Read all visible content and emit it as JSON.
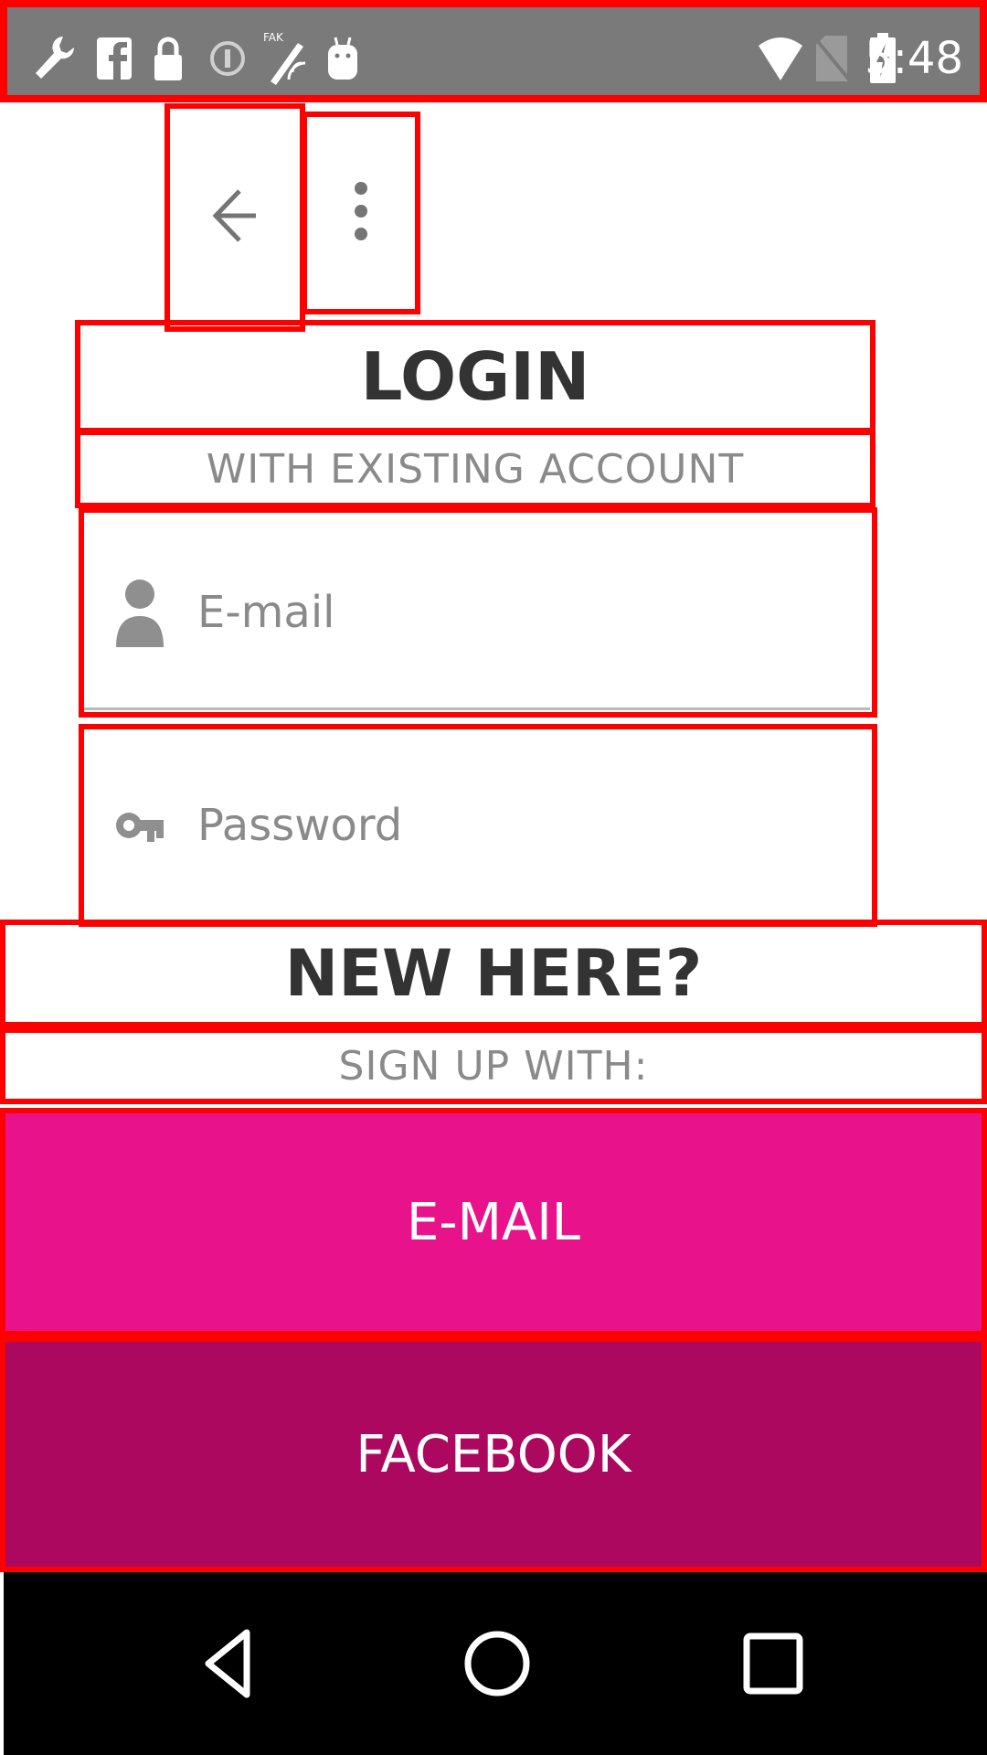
{
  "status_bar": {
    "time": "5:48",
    "left_icons": [
      "wrench-icon",
      "facebook-icon",
      "lock-icon",
      "circle-i-icon",
      "fake-gps-icon",
      "android-icon"
    ],
    "right_icons": [
      "wifi-icon",
      "no-sim-icon",
      "battery-charging-icon"
    ],
    "background": "#7a7a7a"
  },
  "toolbar": {
    "back_icon": "arrow-left-icon",
    "more_icon": "more-vert-icon"
  },
  "login": {
    "title": "LOGIN",
    "subtitle": "WITH EXISTING ACCOUNT",
    "email_placeholder": "E-mail",
    "email_icon": "person-icon",
    "password_placeholder": "Password",
    "password_icon": "key-icon"
  },
  "signup": {
    "title": "NEW HERE?",
    "subtitle": "SIGN UP WITH:",
    "email_button": "E-MAIL",
    "facebook_button": "FACEBOOK",
    "email_button_color": "#e8128a",
    "facebook_button_color": "#ad085f"
  },
  "nav_bar": {
    "icons": [
      "nav-back-icon",
      "nav-home-icon",
      "nav-recents-icon"
    ]
  }
}
